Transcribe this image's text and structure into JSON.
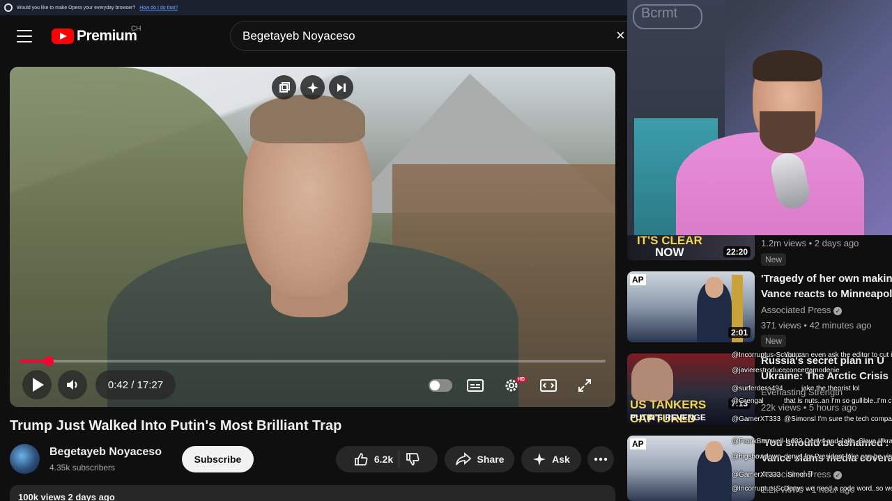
{
  "opera_banner": {
    "message": "Would you like to make Opera your everyday browser?",
    "link": "How do I do that?"
  },
  "header": {
    "logo_text": "Premium",
    "region": "CH",
    "search_value": "Begetayeb Noyaceso",
    "clear_icon": "×"
  },
  "player": {
    "time": "0:42 / 17:27",
    "progress_fraction": 0.05,
    "hd_badge": "HD"
  },
  "video": {
    "title": "Trump Just Walked Into Putin's Most Brilliant Trap",
    "channel_name": "Begetayeb Noyaceso",
    "subscribers": "4.35k subscribers",
    "subscribe_label": "Subscribe",
    "like_count": "6.2k",
    "share_label": "Share",
    "ask_label": "Ask",
    "views_line": "100k views  2 days ago"
  },
  "webcam": {
    "logo_text": "Bcrmt"
  },
  "recommendations": [
    {
      "thumb_text_1": "IT'S CLEAR",
      "thumb_text_2": "NOW",
      "duration": "22:20",
      "meta": "1.2m views • 2 days ago",
      "badge": "New"
    },
    {
      "title_1": "'Tragedy of her own making",
      "title_2": "Vance reacts to Minneapolis",
      "channel": "Associated Press",
      "meta": "371 views • 42 minutes ago",
      "duration": "2:01",
      "badge": "New",
      "ap": "AP"
    },
    {
      "title_1": "Russia's secret plan in U",
      "title_2": "Ukraine: The Arctic Crisis ...",
      "channel": "Everlasting Strength",
      "meta": "22k views • 5 hours ago",
      "duration": "7:13",
      "thumb_text_1": "US TANKERS CAPTURED",
      "thumb_text_2": "PUTIN'S REVENGE"
    },
    {
      "title_1": "'You should be ashamed': JD",
      "title_2": "Vance slams media coverage",
      "channel": "Associated Press",
      "meta": "1.2k views • 1 hour ago",
      "ap": "AP"
    }
  ],
  "chat": [
    {
      "user": "@Incorruptus-Sculptor",
      "msg": "You can even ask the editor to cut in news headlines...etc"
    },
    {
      "user": "@javierestroduceconcertamodenie",
      "msg": ""
    },
    {
      "user": "@surferdess494",
      "msg": "jake the theorist lol"
    },
    {
      "user": "@Grengal",
      "msg": "that is nuts..an I'm so gullible..I'm cooked"
    },
    {
      "user": "@GamerXT333",
      "msg": "@Simonsl I'm sure the tech companies like that"
    },
    {
      "user": "@FrankBarnwell-lsd32",
      "msg": "Denys and Jake. Slava Ukraini"
    },
    {
      "user": "@bigshowdown",
      "msg": "denys for President jake can be vise president"
    },
    {
      "user": "@GamerXT333",
      "msg": "Simonsl"
    },
    {
      "user": "@Incorruptus-Sculptor",
      "msg": "Denys we need a code word..so we know it is you!"
    }
  ],
  "colors": {
    "accent_red": "#ff0033",
    "background": "#0f0f0f",
    "pill": "#272727"
  },
  "icons": {
    "menu": "hamburger-icon",
    "play": "play-icon",
    "volume": "volume-icon",
    "settings": "gear-icon",
    "like": "thumbs-up-icon",
    "dislike": "thumbs-down-icon",
    "share": "share-icon",
    "ask": "sparkle-icon",
    "more": "more-icon"
  }
}
